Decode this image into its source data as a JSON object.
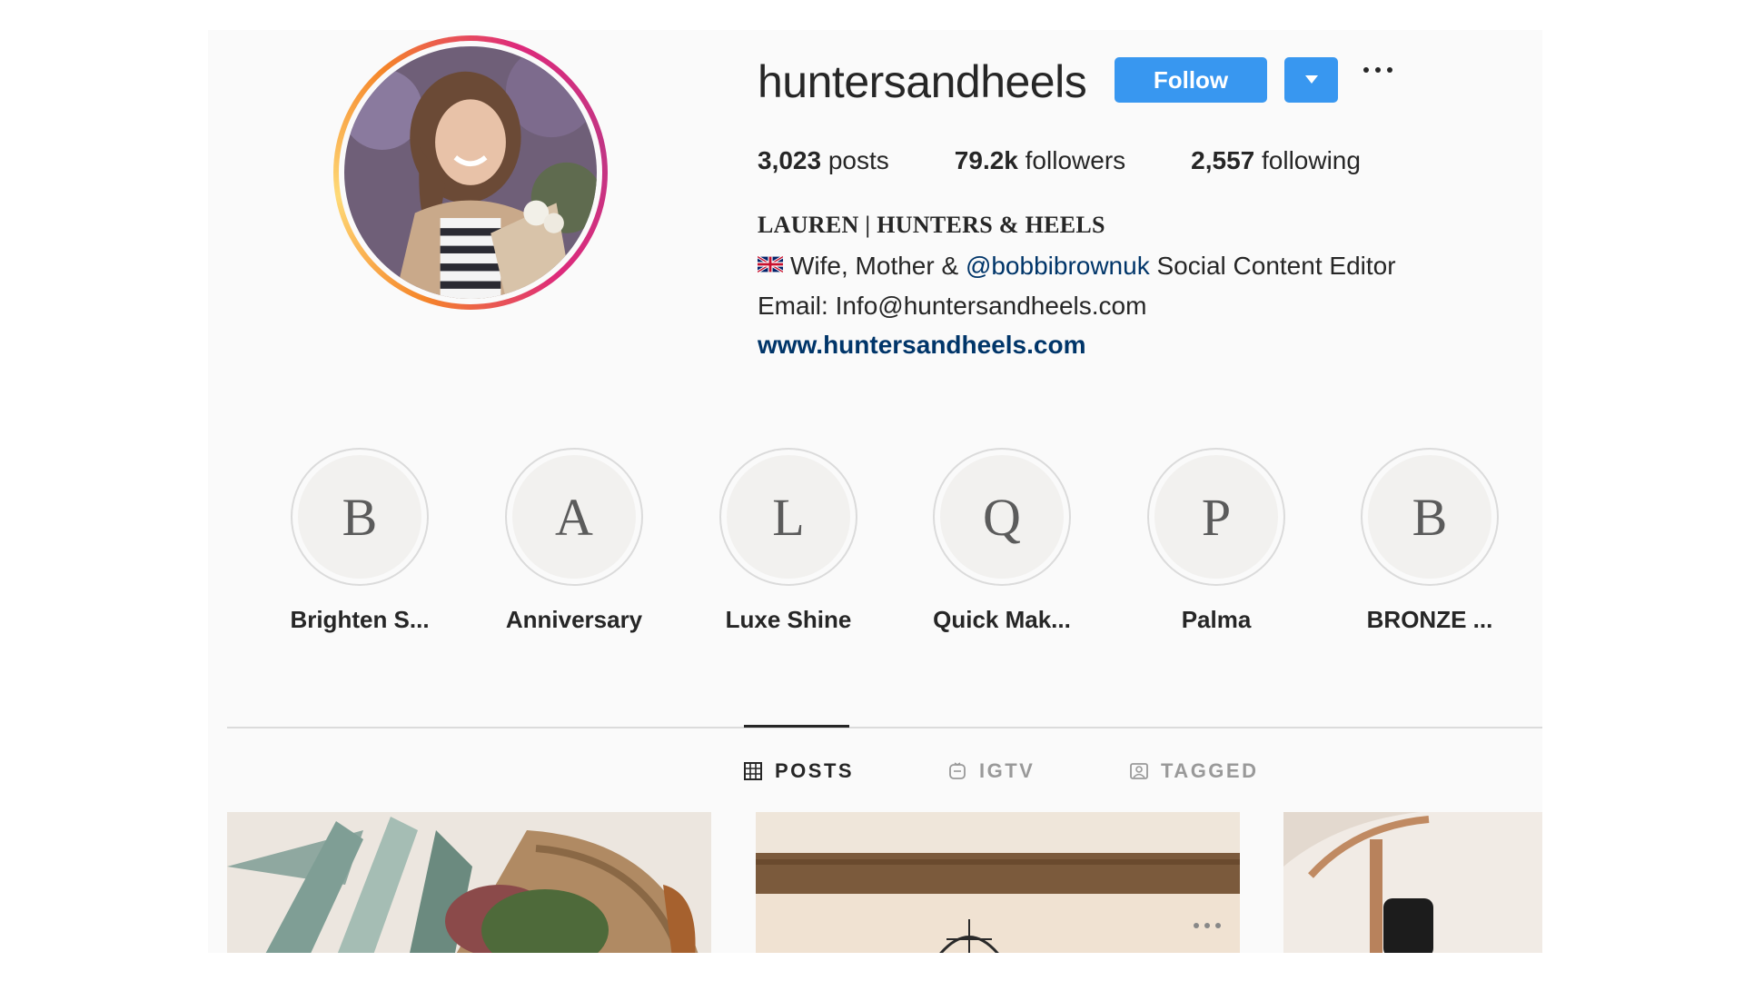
{
  "profile": {
    "username": "huntersandheels",
    "follow_label": "Follow",
    "stats": {
      "posts_count": "3,023",
      "posts_label": "posts",
      "followers_count": "79.2k",
      "followers_label": "followers",
      "following_count": "2,557",
      "following_label": "following"
    },
    "bio": {
      "name": "LAUREN | HUNTERS & HEELS",
      "line1_prefix": "Wife, Mother & ",
      "mention": "@bobbibrownuk",
      "line1_suffix": " Social Content Editor",
      "email": "Email: Info@huntersandheels.com",
      "website": "www.huntersandheels.com"
    }
  },
  "highlights": [
    {
      "letter": "B",
      "label": "Brighten S..."
    },
    {
      "letter": "A",
      "label": "Anniversary"
    },
    {
      "letter": "L",
      "label": "Luxe Shine"
    },
    {
      "letter": "Q",
      "label": "Quick Mak..."
    },
    {
      "letter": "P",
      "label": "Palma"
    },
    {
      "letter": "B",
      "label": "BRONZE ..."
    }
  ],
  "tabs": [
    {
      "label": "POSTS",
      "icon": "grid-icon",
      "active": true
    },
    {
      "label": "IGTV",
      "icon": "igtv-icon",
      "active": false
    },
    {
      "label": "TAGGED",
      "icon": "tagged-icon",
      "active": false
    }
  ],
  "colors": {
    "follow_button": "#3897f0",
    "link": "#003569",
    "background": "#fafafa"
  }
}
